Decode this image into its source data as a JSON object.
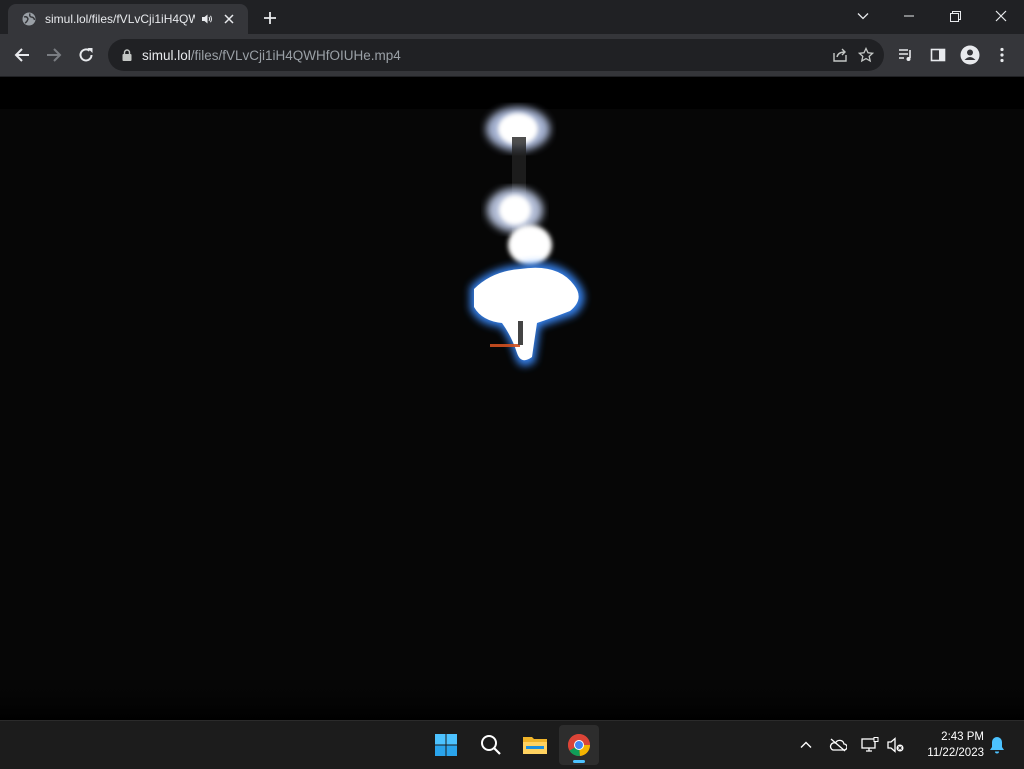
{
  "browser": {
    "tab": {
      "title": "simul.lol/files/fVLvCji1iH4QWHfOIUHe.mp4"
    },
    "address_bar": {
      "host": "simul.lol",
      "path": "/files/fVLvCji1iH4QWHfOIUHe.mp4"
    },
    "icons": {
      "favicon": "globe-icon",
      "audio": "speaker-icon",
      "close_tab": "close-icon",
      "new_tab": "plus-icon",
      "tab_search": "chevron-down-icon",
      "minimize": "minimize-icon",
      "maximize": "restore-icon",
      "close_window": "close-icon",
      "back": "back-arrow-icon",
      "forward": "forward-arrow-icon",
      "reload": "reload-icon",
      "lock": "lock-icon",
      "share": "share-icon",
      "bookmark": "star-icon",
      "media": "media-control-icon",
      "side_panel": "side-panel-icon",
      "profile": "profile-icon",
      "menu": "kebab-menu-icon"
    }
  },
  "taskbar": {
    "apps": [
      "start-icon",
      "search-icon",
      "file-explorer-icon",
      "chrome-icon"
    ],
    "tray": [
      "chevron-up-icon",
      "onedrive-icon",
      "network-icon",
      "volume-muted-icon",
      "notification-bell-icon"
    ],
    "clock": {
      "time": "2:43 PM",
      "date": "11/22/2023"
    }
  },
  "colors": {
    "titlebar": "#202124",
    "toolbar": "#35363a",
    "video_bg": "#060606",
    "taskbar": "#1c1c1c",
    "accent": "#4cc2ff"
  }
}
